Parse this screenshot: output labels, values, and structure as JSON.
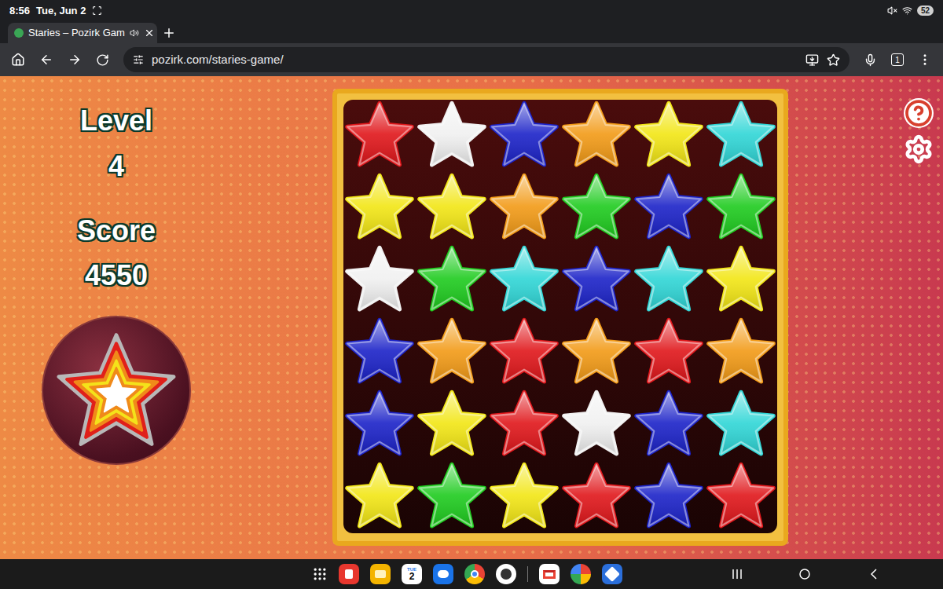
{
  "status_bar": {
    "time": "8:56",
    "date": "Tue, Jun 2",
    "battery": "52"
  },
  "browser": {
    "tabs": [
      {
        "title": "Staries – Pozirk Gam",
        "selected": true
      }
    ],
    "address": "pozirk.com/staries-game/",
    "tab_count": "1"
  },
  "game": {
    "level_label": "Level",
    "level": "4",
    "score_label": "Score",
    "score": "4550",
    "board": [
      [
        {
          "color": "#e0161a"
        },
        {
          "color": "#f0f0f0"
        },
        {
          "color": "#1b22c8"
        },
        {
          "color": "#f29a16"
        },
        {
          "color": "#f2e614"
        },
        {
          "color": "#2fd6d6"
        }
      ],
      [
        {
          "color": "#f2e614"
        },
        {
          "color": "#f2e614"
        },
        {
          "color": "#f29a16"
        },
        {
          "color": "#1ecb1e"
        },
        {
          "color": "#1b22c8"
        },
        {
          "color": "#1ecb1e"
        }
      ],
      [
        {
          "color": "#f0f0f0"
        },
        {
          "color": "#1ecb1e"
        },
        {
          "color": "#2fd6d6"
        },
        {
          "color": "#1b22c8"
        },
        {
          "color": "#2fd6d6"
        },
        {
          "color": "#f2e614"
        }
      ],
      [
        {
          "color": "#1b22c8"
        },
        {
          "color": "#f29a16"
        },
        {
          "color": "#e0161a"
        },
        {
          "color": "#f29a16"
        },
        {
          "color": "#e0161a"
        },
        {
          "color": "#f29a16"
        }
      ],
      [
        {
          "color": "#1b22c8"
        },
        {
          "color": "#f2e614"
        },
        {
          "color": "#e0161a"
        },
        {
          "color": "#f0f0f0"
        },
        {
          "color": "#1b22c8"
        },
        {
          "color": "#2fd6d6"
        }
      ],
      [
        {
          "color": "#f2e614"
        },
        {
          "color": "#1ecb1e"
        },
        {
          "color": "#f2e614"
        },
        {
          "color": "#e0161a"
        },
        {
          "color": "#1b22c8"
        },
        {
          "color": "#e0161a"
        }
      ]
    ]
  },
  "dock": {
    "calendar_day": "TUE",
    "calendar_date": "2"
  }
}
